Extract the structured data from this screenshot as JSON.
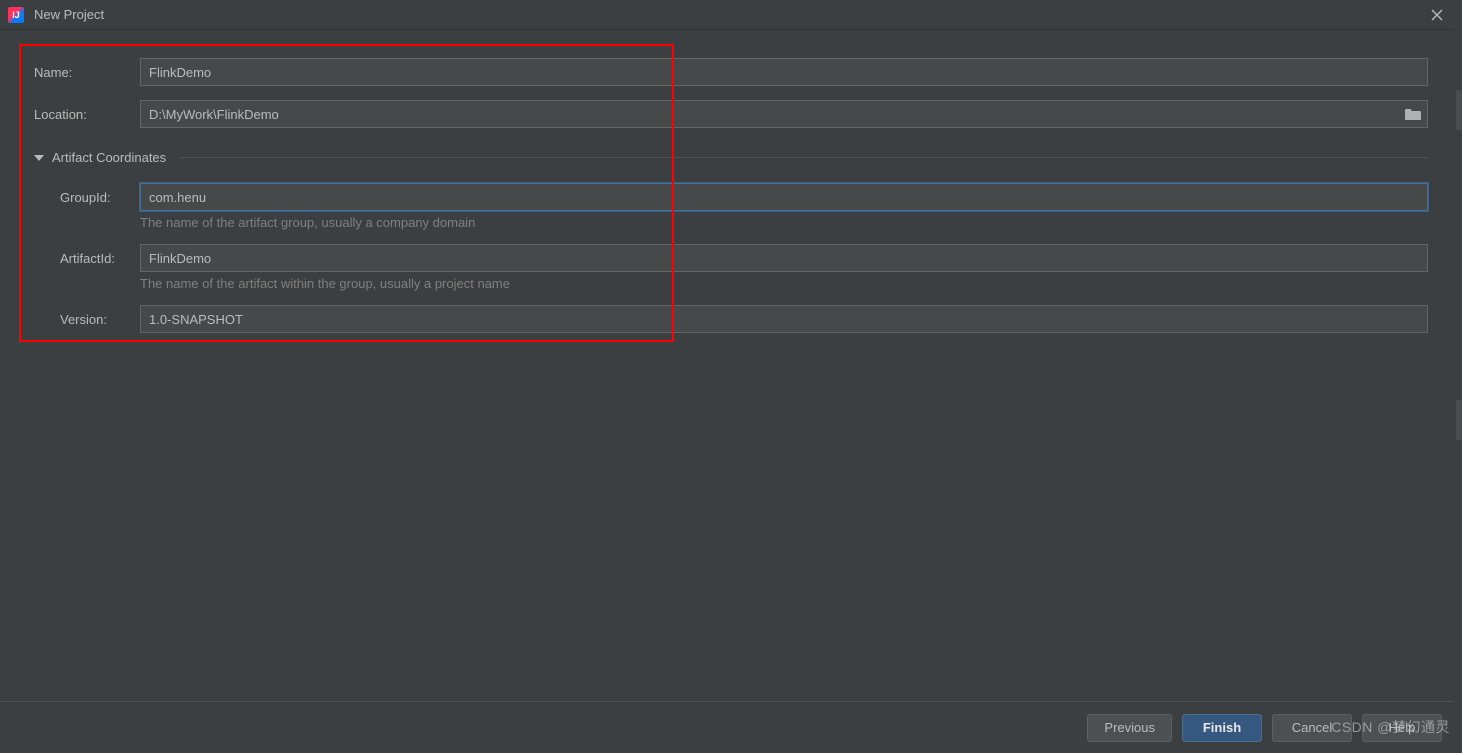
{
  "window": {
    "title": "New Project"
  },
  "form": {
    "name_label": "Name:",
    "name_value": "FlinkDemo",
    "location_label": "Location:",
    "location_value": "D:\\MyWork\\FlinkDemo"
  },
  "artifact": {
    "section_title": "Artifact Coordinates",
    "group_label": "GroupId:",
    "group_value": "com.henu",
    "group_hint": "The name of the artifact group, usually a company domain",
    "artifact_label": "ArtifactId:",
    "artifact_value": "FlinkDemo",
    "artifact_hint": "The name of the artifact within the group, usually a project name",
    "version_label": "Version:",
    "version_value": "1.0-SNAPSHOT"
  },
  "footer": {
    "previous": "Previous",
    "finish": "Finish",
    "cancel": "Cancel",
    "help": "Help"
  },
  "watermark": "CSDN @梦幻通灵"
}
